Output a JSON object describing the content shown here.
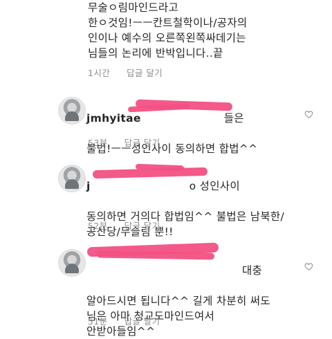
{
  "top_comment": {
    "text": "무술ㅇ림마인드라고\n한ㅇ것임!ㅡㅡ칸트철학이나/공자의\n인이나 예수의 오른쪽왼쪽싸데기는\n님들의 논리에 반박입니다..끝",
    "time": "1시간",
    "reply_label": "답글 달기"
  },
  "comments": [
    {
      "username": "jmhyitae",
      "text_after_name": "들은",
      "text": "불법!ㅡㅡ성인사이 동의하면 합법^^",
      "time": "53분",
      "reply_label": "답글 달기"
    },
    {
      "username": "j",
      "text_after_name": "o 성인사이",
      "text": "동의하면 거의다 합법임^^ 불법은 남북한/\n공산당/무슬림 뿐!!",
      "time": "52분",
      "reply_label": "답글 달기"
    },
    {
      "username": "",
      "text_after_name": "대충",
      "text": "알아드시면 됩니다^^ 길게 차분히 써도\n님은 아마 청교도마인드여서\n안받아들임^^",
      "time": "51분",
      "reply_label": "답글 달기"
    }
  ],
  "icons": {
    "like": "heart-outline-icon",
    "avatar": "profile-avatar"
  },
  "colors": {
    "text": "#262626",
    "meta": "#8e8e8e",
    "redaction": "#f25083"
  }
}
